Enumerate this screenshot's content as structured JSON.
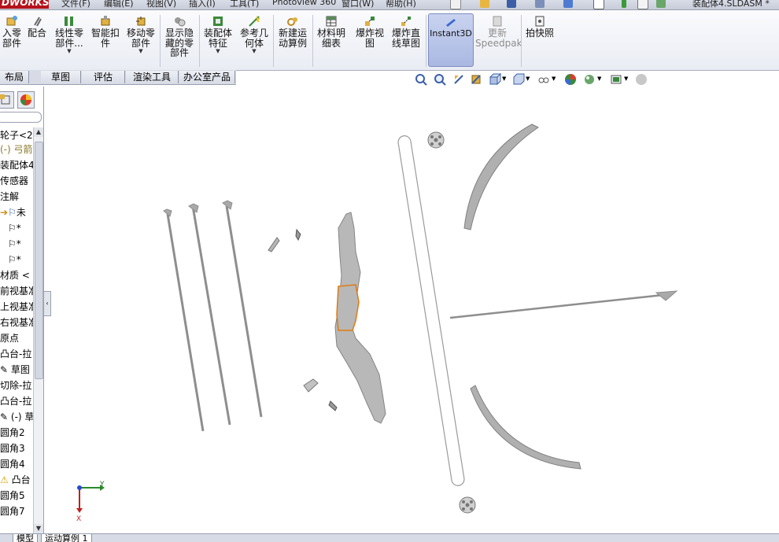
{
  "app": {
    "brand": "DWORKS",
    "document_title": "装配体4.SLDASM *"
  },
  "menu": [
    "文件(F)",
    "编辑(E)",
    "视图(V)",
    "插入(I)",
    "工具(T)",
    "Photoview 360",
    "窗口(W)",
    "帮助(H)"
  ],
  "ribbon": {
    "buttons": [
      {
        "id": "insert-component",
        "label": "入零\n部件",
        "dropdown": false
      },
      {
        "id": "mate",
        "label": "配合",
        "dropdown": false
      },
      {
        "id": "linear-pattern",
        "label": "线性零\n部件...",
        "dropdown": true
      },
      {
        "id": "smart-fasteners",
        "label": "智能扣\n件",
        "dropdown": false
      },
      {
        "id": "move-component",
        "label": "移动零\n部件",
        "dropdown": true
      },
      {
        "id": "show-hidden",
        "label": "显示隐\n藏的零\n部件",
        "dropdown": false
      },
      {
        "id": "assembly-feature",
        "label": "装配体\n特征",
        "dropdown": true
      },
      {
        "id": "reference-geometry",
        "label": "参考几\n何体",
        "dropdown": true
      },
      {
        "id": "new-motion-study",
        "label": "新建运\n动算例",
        "dropdown": false
      },
      {
        "id": "bom",
        "label": "材料明\n细表",
        "dropdown": false
      },
      {
        "id": "exploded-view",
        "label": "爆炸视\n图",
        "dropdown": false
      },
      {
        "id": "explode-line-sketch",
        "label": "爆炸直\n线草图",
        "dropdown": false
      },
      {
        "id": "instant3d",
        "label": "Instant3D",
        "dropdown": false
      },
      {
        "id": "update-speedpak",
        "label": "更新\nSpeedpak",
        "dropdown": false
      },
      {
        "id": "snapshot",
        "label": "拍快照",
        "dropdown": false
      }
    ]
  },
  "tabs": [
    "布局",
    "草图",
    "评估",
    "渲染工具",
    "办公室产品"
  ],
  "tree": {
    "items": [
      "轮子<2:",
      "(-) 弓箭",
      "装配体4",
      "传感器",
      "注解",
      "未",
      "*",
      "*",
      "*",
      "材质 <",
      "前视基准",
      "上视基准",
      "右视基准",
      "原点",
      "凸台-拉",
      "草图",
      "切除-拉",
      "凸台-拉",
      "(-) 草",
      "圆角2",
      "圆角3",
      "圆角4",
      "凸台",
      "圆角5",
      "圆角7"
    ]
  },
  "triad": {
    "x_label": "X",
    "y_label": "Y"
  },
  "bottom_tabs": [
    "模型",
    "运动算例 1"
  ],
  "colors": {
    "brand": "#b5121b",
    "accent_orange": "#e07a10",
    "part_grey": "#a9a9a9"
  }
}
